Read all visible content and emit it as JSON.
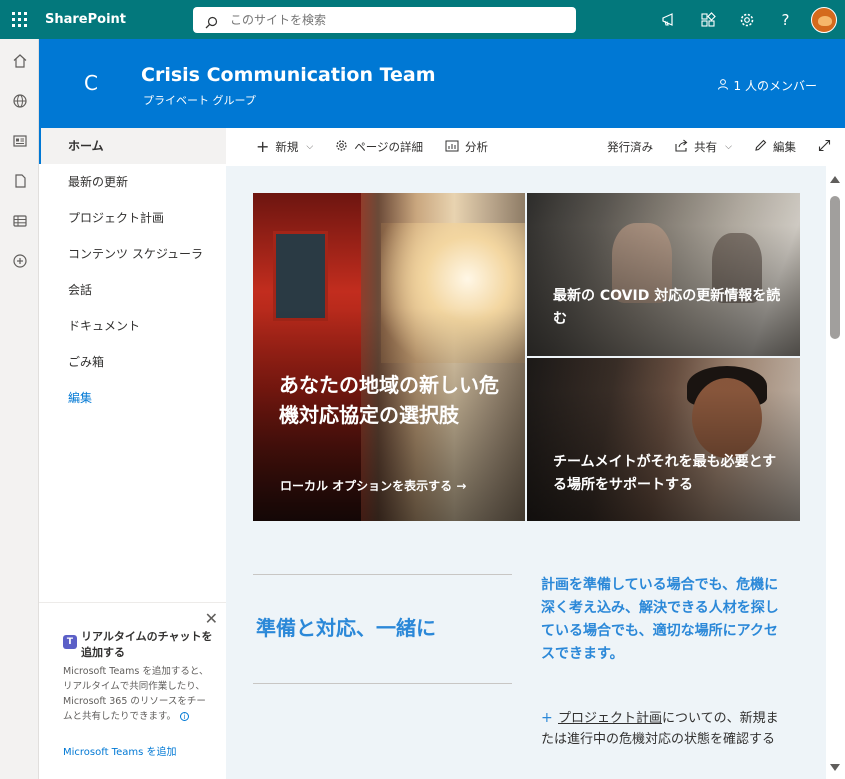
{
  "suite": {
    "brand": "SharePoint",
    "search_placeholder": "このサイトを検索",
    "icons": [
      "megaphone-icon",
      "settings-grid-icon",
      "gear-icon",
      "help-icon"
    ]
  },
  "rail": {
    "icons": [
      "home-icon",
      "globe-icon",
      "news-icon",
      "file-icon",
      "list-icon",
      "add-icon"
    ]
  },
  "site": {
    "logo_letter": "C",
    "title": "Crisis Communication Team",
    "subtitle": "プライベート グループ",
    "members": "1 人のメンバー"
  },
  "nav": {
    "items": [
      "ホーム",
      "最新の更新",
      "プロジェクト計画",
      "コンテンツ スケジューラ",
      "会話",
      "ドキュメント",
      "ごみ箱"
    ],
    "edit": "編集"
  },
  "teams": {
    "title": "リアルタイムのチャットを追加する",
    "body": "Microsoft Teams を追加すると、リアルタイムで共同作業したり、Microsoft 365 のリソースをチームと共有したりできます。",
    "link": "Microsoft Teams を追加"
  },
  "cmdbar": {
    "new": "新規",
    "page_details": "ページの詳細",
    "analytics": "分析",
    "published": "発行済み",
    "share": "共有",
    "edit": "編集"
  },
  "hero": {
    "main_title": "あなたの地域の新しい危機対応協定の選択肢",
    "main_link": "ローカル オプションを表示する →",
    "tile1_title": "最新の COVID 対応の更新情報を読む",
    "tile2_title": "チームメイトがそれを最も必要とする場所をサポートする"
  },
  "section": {
    "heading": "準備と対応、一緒に",
    "quote": "計画を準備している場合でも、危機に深く考え込み、解決できる人材を探している場合でも、適切な場所にアクセスできます。",
    "plus": "+",
    "item_link": "プロジェクト計画",
    "item_text": "についての、新規または進行中の危機対応の状態を確認する"
  },
  "colors": {
    "suite": "#03787c",
    "header": "#0078d4",
    "accent_text": "#2b88d8"
  }
}
